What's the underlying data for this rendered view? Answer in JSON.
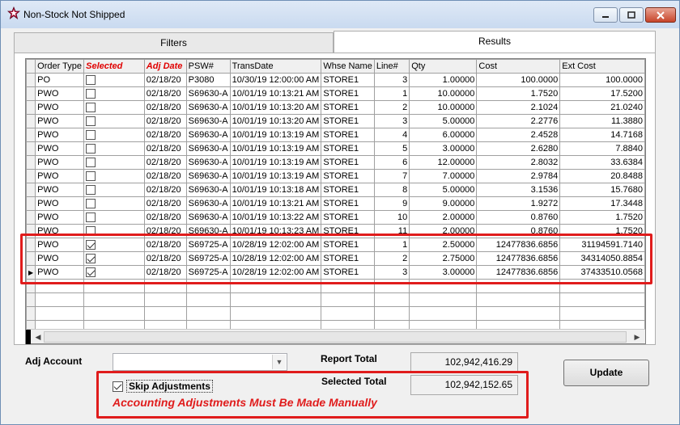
{
  "window": {
    "title": "Non-Stock Not Shipped"
  },
  "tabs": [
    {
      "label": "Filters",
      "active": false
    },
    {
      "label": "Results",
      "active": true
    }
  ],
  "grid": {
    "columns": [
      "Order Type",
      "Selected",
      "Adj Date",
      "PSW#",
      "TransDate",
      "Whse Name",
      "Line#",
      "Qty",
      "Cost",
      "Ext Cost"
    ],
    "rows": [
      {
        "type": "PO",
        "selected": false,
        "adj_date": "02/18/20",
        "psw": "P3080",
        "trans": "10/30/19 12:00:00 AM",
        "whse": "STORE1",
        "line": "3",
        "qty": "1.00000",
        "cost": "100.0000",
        "ext": "100.0000"
      },
      {
        "type": "PWO",
        "selected": false,
        "adj_date": "02/18/20",
        "psw": "S69630-A",
        "trans": "10/01/19 10:13:21 AM",
        "whse": "STORE1",
        "line": "1",
        "qty": "10.00000",
        "cost": "1.7520",
        "ext": "17.5200"
      },
      {
        "type": "PWO",
        "selected": false,
        "adj_date": "02/18/20",
        "psw": "S69630-A",
        "trans": "10/01/19 10:13:20 AM",
        "whse": "STORE1",
        "line": "2",
        "qty": "10.00000",
        "cost": "2.1024",
        "ext": "21.0240"
      },
      {
        "type": "PWO",
        "selected": false,
        "adj_date": "02/18/20",
        "psw": "S69630-A",
        "trans": "10/01/19 10:13:20 AM",
        "whse": "STORE1",
        "line": "3",
        "qty": "5.00000",
        "cost": "2.2776",
        "ext": "11.3880"
      },
      {
        "type": "PWO",
        "selected": false,
        "adj_date": "02/18/20",
        "psw": "S69630-A",
        "trans": "10/01/19 10:13:19 AM",
        "whse": "STORE1",
        "line": "4",
        "qty": "6.00000",
        "cost": "2.4528",
        "ext": "14.7168"
      },
      {
        "type": "PWO",
        "selected": false,
        "adj_date": "02/18/20",
        "psw": "S69630-A",
        "trans": "10/01/19 10:13:19 AM",
        "whse": "STORE1",
        "line": "5",
        "qty": "3.00000",
        "cost": "2.6280",
        "ext": "7.8840"
      },
      {
        "type": "PWO",
        "selected": false,
        "adj_date": "02/18/20",
        "psw": "S69630-A",
        "trans": "10/01/19 10:13:19 AM",
        "whse": "STORE1",
        "line": "6",
        "qty": "12.00000",
        "cost": "2.8032",
        "ext": "33.6384"
      },
      {
        "type": "PWO",
        "selected": false,
        "adj_date": "02/18/20",
        "psw": "S69630-A",
        "trans": "10/01/19 10:13:19 AM",
        "whse": "STORE1",
        "line": "7",
        "qty": "7.00000",
        "cost": "2.9784",
        "ext": "20.8488"
      },
      {
        "type": "PWO",
        "selected": false,
        "adj_date": "02/18/20",
        "psw": "S69630-A",
        "trans": "10/01/19 10:13:18 AM",
        "whse": "STORE1",
        "line": "8",
        "qty": "5.00000",
        "cost": "3.1536",
        "ext": "15.7680"
      },
      {
        "type": "PWO",
        "selected": false,
        "adj_date": "02/18/20",
        "psw": "S69630-A",
        "trans": "10/01/19 10:13:21 AM",
        "whse": "STORE1",
        "line": "9",
        "qty": "9.00000",
        "cost": "1.9272",
        "ext": "17.3448"
      },
      {
        "type": "PWO",
        "selected": false,
        "adj_date": "02/18/20",
        "psw": "S69630-A",
        "trans": "10/01/19 10:13:22 AM",
        "whse": "STORE1",
        "line": "10",
        "qty": "2.00000",
        "cost": "0.8760",
        "ext": "1.7520"
      },
      {
        "type": "PWO",
        "selected": false,
        "adj_date": "02/18/20",
        "psw": "S69630-A",
        "trans": "10/01/19 10:13:23 AM",
        "whse": "STORE1",
        "line": "11",
        "qty": "2.00000",
        "cost": "0.8760",
        "ext": "1.7520"
      },
      {
        "type": "PWO",
        "selected": true,
        "adj_date": "02/18/20",
        "psw": "S69725-A",
        "trans": "10/28/19 12:02:00 AM",
        "whse": "STORE1",
        "line": "1",
        "qty": "2.50000",
        "cost": "12477836.6856",
        "ext": "31194591.7140"
      },
      {
        "type": "PWO",
        "selected": true,
        "adj_date": "02/18/20",
        "psw": "S69725-A",
        "trans": "10/28/19 12:02:00 AM",
        "whse": "STORE1",
        "line": "2",
        "qty": "2.75000",
        "cost": "12477836.6856",
        "ext": "34314050.8854"
      },
      {
        "type": "PWO",
        "selected": true,
        "adj_date": "02/18/20",
        "psw": "S69725-A",
        "trans": "10/28/19 12:02:00 AM",
        "whse": "STORE1",
        "line": "3",
        "qty": "3.00000",
        "cost": "12477836.6856",
        "ext": "37433510.0568"
      }
    ],
    "empty_rows": 5
  },
  "form": {
    "adj_account_label": "Adj Account",
    "adj_account_value": "",
    "report_total_label": "Report Total",
    "report_total_value": "102,942,416.29",
    "selected_total_label": "Selected Total",
    "selected_total_value": "102,942,152.65",
    "update_label": "Update",
    "skip_label": "Skip Adjustments",
    "skip_checked": true,
    "note": "Accounting Adjustments Must Be Made Manually"
  },
  "colors": {
    "highlight": "#e01c1c",
    "header_red": "#e00000"
  }
}
